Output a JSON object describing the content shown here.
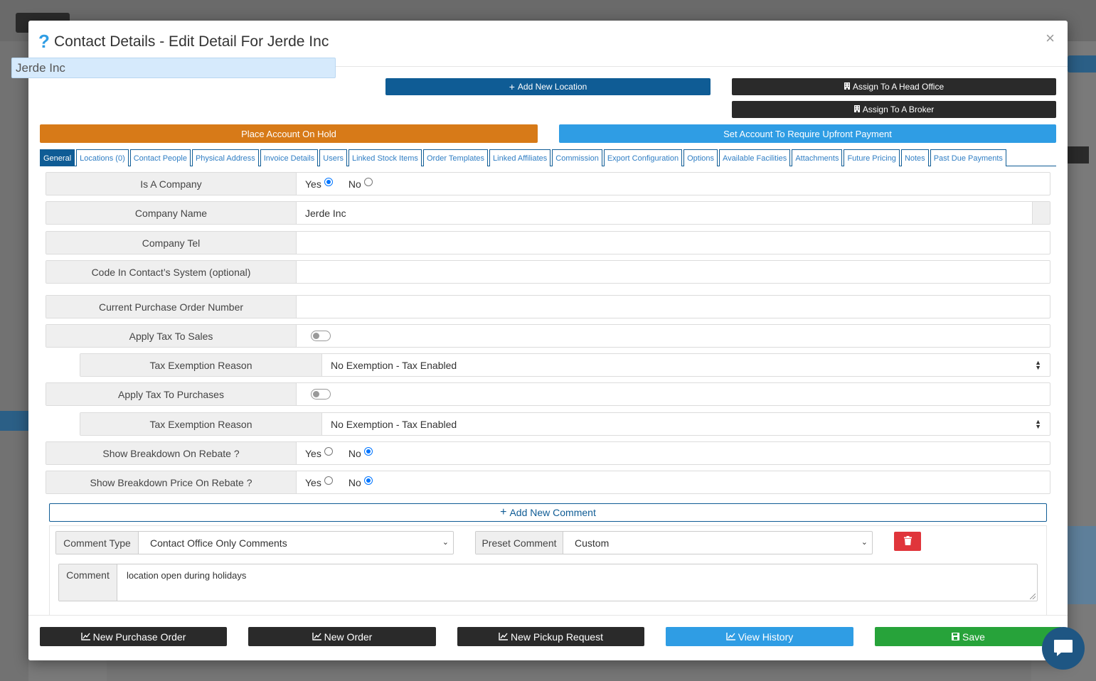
{
  "modal": {
    "help_icon": "?",
    "title": "Contact Details - Edit Detail For Jerde Inc",
    "close_icon": "×"
  },
  "top": {
    "contact_name_value": "Jerde Inc",
    "add_location_label": "Add New Location",
    "assign_head_office_label": "Assign To A Head Office",
    "assign_broker_label": "Assign To A Broker",
    "place_on_hold_label": "Place Account On Hold",
    "require_upfront_label": "Set Account To Require Upfront Payment"
  },
  "tabs": [
    {
      "label": "General",
      "active": true
    },
    {
      "label": "Locations (0)"
    },
    {
      "label": "Contact People"
    },
    {
      "label": "Physical Address"
    },
    {
      "label": "Invoice Details"
    },
    {
      "label": "Users"
    },
    {
      "label": "Linked Stock Items"
    },
    {
      "label": "Order Templates"
    },
    {
      "label": "Linked Affiliates"
    },
    {
      "label": "Commission"
    },
    {
      "label": "Export Configuration"
    },
    {
      "label": "Options"
    },
    {
      "label": "Available Facilities"
    },
    {
      "label": "Attachments"
    },
    {
      "label": "Future Pricing"
    },
    {
      "label": "Notes"
    },
    {
      "label": "Past Due Payments"
    }
  ],
  "form": {
    "is_company": {
      "label": "Is A Company",
      "yes": "Yes",
      "no": "No",
      "selected": "Yes"
    },
    "company_name": {
      "label": "Company Name",
      "value": "Jerde Inc"
    },
    "company_tel": {
      "label": "Company Tel",
      "value": ""
    },
    "code_in_system": {
      "label": "Code In Contact’s System (optional)",
      "value": ""
    },
    "current_po": {
      "label": "Current Purchase Order Number",
      "value": ""
    },
    "apply_tax_sales": {
      "label": "Apply Tax To Sales",
      "on": false
    },
    "tax_exemption_sales": {
      "label": "Tax Exemption Reason",
      "value": "No Exemption - Tax Enabled"
    },
    "apply_tax_purchases": {
      "label": "Apply Tax To Purchases",
      "on": false
    },
    "tax_exemption_purchases": {
      "label": "Tax Exemption Reason",
      "value": "No Exemption - Tax Enabled"
    },
    "breakdown_rebate": {
      "label": "Show Breakdown On Rebate ?",
      "yes": "Yes",
      "no": "No",
      "selected": "No"
    },
    "breakdown_price_rebate": {
      "label": "Show Breakdown Price On Rebate ?",
      "yes": "Yes",
      "no": "No",
      "selected": "No"
    }
  },
  "comments": {
    "add_label": "Add New Comment",
    "comment_type_label": "Comment Type",
    "comment_type_value": "Contact Office Only Comments",
    "preset_label": "Preset Comment",
    "preset_value": "Custom",
    "comment_label": "Comment",
    "comment_value": "location open during holidays"
  },
  "footer": {
    "new_purchase_order": "New Purchase Order",
    "new_order": "New Order",
    "new_pickup_request": "New Pickup Request",
    "view_history": "View History",
    "save": "Save"
  },
  "colors": {
    "primary_dark": "#0f5c95",
    "dark": "#2a2a2a",
    "orange": "#d77a18",
    "sky": "#2f9de4",
    "green": "#27a33a",
    "red": "#e0353b"
  }
}
